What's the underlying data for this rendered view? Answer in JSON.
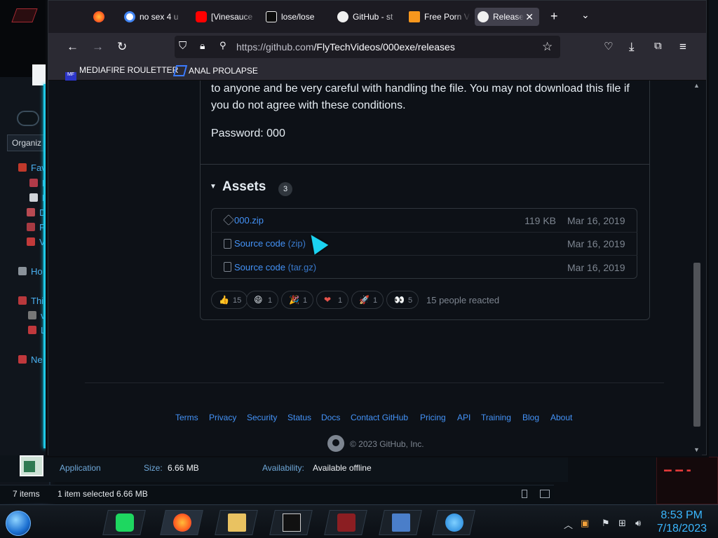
{
  "colors": {
    "page_bg": "#0d1117",
    "link": "#4493f8",
    "muted": "#7d8590",
    "border": "#30363d",
    "neon": "#1ec8e6",
    "clock": "#3ab7ff"
  },
  "browser": {
    "tabs": [
      {
        "icon": "firefox-icon",
        "title": ""
      },
      {
        "icon": "google-icon",
        "title": "no sex 4 u"
      },
      {
        "icon": "youtube-icon",
        "title": "[Vinesauce"
      },
      {
        "icon": "game-icon",
        "title": "lose/lose"
      },
      {
        "icon": "github-icon",
        "title": "GitHub - st"
      },
      {
        "icon": "ph-icon",
        "title": "Free Porn V"
      },
      {
        "icon": "github-icon",
        "title": "Releases"
      }
    ],
    "url_host": "https://github.com",
    "url_path": "/FlyTechVideos/000exe/releases",
    "bookmarks": [
      "MEDIAFIRE ROULETTER",
      "ANAL PROLAPSE"
    ],
    "bookmark_icon_text": "MF"
  },
  "release": {
    "body_line1": "to anyone and be very careful with handling the file. You may not download this file if",
    "body_line2": "you do not agree with these conditions.",
    "password": "Password: 000",
    "assets_title": "Assets",
    "assets_count": "3",
    "assets": [
      {
        "name": "000.zip",
        "suffix": "",
        "size": "119 KB",
        "date": "Mar 16, 2019",
        "icon": "package-icon"
      },
      {
        "name": "Source code",
        "suffix": "(zip)",
        "size": "",
        "date": "Mar 16, 2019",
        "icon": "file-zip-icon"
      },
      {
        "name": "Source code",
        "suffix": "(tar.gz)",
        "size": "",
        "date": "Mar 16, 2019",
        "icon": "file-zip-icon"
      }
    ],
    "reactions": [
      {
        "emoji": "👍",
        "count": "15",
        "name": "thumbs-up"
      },
      {
        "emoji": "😄",
        "count": "1",
        "name": "laugh"
      },
      {
        "emoji": "🎉",
        "count": "1",
        "name": "hooray"
      },
      {
        "emoji": "❤",
        "count": "1",
        "name": "heart"
      },
      {
        "emoji": "🚀",
        "count": "1",
        "name": "rocket"
      },
      {
        "emoji": "👀",
        "count": "5",
        "name": "eyes"
      }
    ],
    "reactors_text": "15 people reacted"
  },
  "footer": {
    "links": [
      "Terms",
      "Privacy",
      "Security",
      "Status",
      "Docs",
      "Contact GitHub",
      "Pricing",
      "API",
      "Training",
      "Blog",
      "About"
    ],
    "copyright": "© 2023 GitHub, Inc."
  },
  "explorer": {
    "organize": "Organiz",
    "nav": [
      "Fav",
      "D",
      "D",
      "D",
      "F",
      "V",
      "Ho",
      "Thi",
      "v",
      "L",
      "Ne"
    ],
    "details": {
      "type": "Application",
      "size_label": "Size:",
      "size_value": "6.66 MB",
      "availability_label": "Availability:",
      "availability_value": "Available offline"
    },
    "status": {
      "items": "7 items",
      "selected": "1 item selected  6.66 MB"
    }
  },
  "taskbar": {
    "time": "8:53 PM",
    "date": "7/18/2023"
  }
}
